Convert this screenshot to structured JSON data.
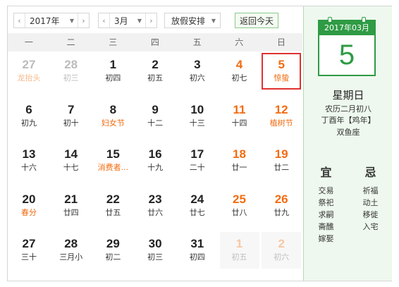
{
  "toolbar": {
    "year": "2017年",
    "month": "3月",
    "holiday_select": "放假安排",
    "today_button": "返回今天"
  },
  "weekdays": [
    "一",
    "二",
    "三",
    "四",
    "五",
    "六",
    "日"
  ],
  "grid": [
    [
      {
        "day": "27",
        "sub": "龙抬头",
        "type": "other festival"
      },
      {
        "day": "28",
        "sub": "初三",
        "type": "other"
      },
      {
        "day": "1",
        "sub": "初四",
        "type": ""
      },
      {
        "day": "2",
        "sub": "初五",
        "type": ""
      },
      {
        "day": "3",
        "sub": "初六",
        "type": ""
      },
      {
        "day": "4",
        "sub": "初七",
        "type": "weekend"
      },
      {
        "day": "5",
        "sub": "惊蛰",
        "type": "weekend festival selected"
      }
    ],
    [
      {
        "day": "6",
        "sub": "初九",
        "type": ""
      },
      {
        "day": "7",
        "sub": "初十",
        "type": ""
      },
      {
        "day": "8",
        "sub": "妇女节",
        "type": "festival"
      },
      {
        "day": "9",
        "sub": "十二",
        "type": ""
      },
      {
        "day": "10",
        "sub": "十三",
        "type": ""
      },
      {
        "day": "11",
        "sub": "十四",
        "type": "weekend"
      },
      {
        "day": "12",
        "sub": "植树节",
        "type": "weekend festival"
      }
    ],
    [
      {
        "day": "13",
        "sub": "十六",
        "type": ""
      },
      {
        "day": "14",
        "sub": "十七",
        "type": ""
      },
      {
        "day": "15",
        "sub": "消费者...",
        "type": "festival"
      },
      {
        "day": "16",
        "sub": "十九",
        "type": ""
      },
      {
        "day": "17",
        "sub": "二十",
        "type": ""
      },
      {
        "day": "18",
        "sub": "廿一",
        "type": "weekend"
      },
      {
        "day": "19",
        "sub": "廿二",
        "type": "weekend"
      }
    ],
    [
      {
        "day": "20",
        "sub": "春分",
        "type": "festival"
      },
      {
        "day": "21",
        "sub": "廿四",
        "type": ""
      },
      {
        "day": "22",
        "sub": "廿五",
        "type": ""
      },
      {
        "day": "23",
        "sub": "廿六",
        "type": ""
      },
      {
        "day": "24",
        "sub": "廿七",
        "type": ""
      },
      {
        "day": "25",
        "sub": "廿八",
        "type": "weekend"
      },
      {
        "day": "26",
        "sub": "廿九",
        "type": "weekend"
      }
    ],
    [
      {
        "day": "27",
        "sub": "三十",
        "type": ""
      },
      {
        "day": "28",
        "sub": "三月小",
        "type": ""
      },
      {
        "day": "29",
        "sub": "初二",
        "type": ""
      },
      {
        "day": "30",
        "sub": "初三",
        "type": ""
      },
      {
        "day": "31",
        "sub": "初四",
        "type": ""
      },
      {
        "day": "1",
        "sub": "初五",
        "type": "ban"
      },
      {
        "day": "2",
        "sub": "初六",
        "type": "ban"
      }
    ]
  ],
  "panel": {
    "header": "2017年03月",
    "day": "5",
    "weekday": "星期日",
    "lunar": "农历二月初八",
    "ganzhi": "丁酉年【鸡年】",
    "zodiac": "双鱼座",
    "yi_label": "宜",
    "ji_label": "忌",
    "yi": [
      "交易",
      "祭祀",
      "求嗣",
      "斋醮",
      "嫁娶"
    ],
    "ji": [
      "祈福",
      "动土",
      "移徙",
      "入宅"
    ]
  },
  "colors": {
    "accent_green": "#2f9b44",
    "weekend_orange": "#f26c12",
    "selected_red": "#e03131"
  }
}
